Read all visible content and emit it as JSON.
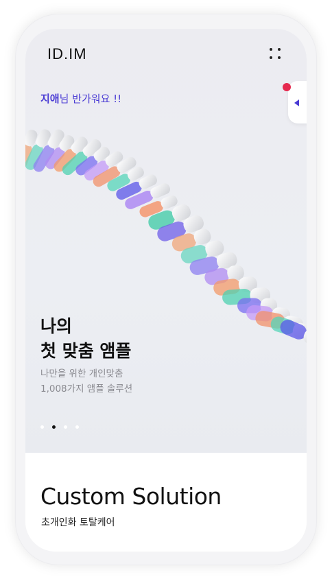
{
  "header": {
    "logo": "ID.IM",
    "menu_icon": "dots-grid-icon"
  },
  "greeting": {
    "name": "지애",
    "text": "님 반가워요 !!"
  },
  "side_tab": {
    "badge_color": "#e5294f",
    "arrow_icon": "caret-left-icon"
  },
  "hero": {
    "headline_line1": "나의",
    "headline_line2": "첫 맞춤 앰플",
    "sub_line1": "나만을 위한 개인맞춤",
    "sub_line2": "1,008가지 앰플 솔루션"
  },
  "carousel": {
    "total": 4,
    "active_index": 1
  },
  "section": {
    "title": "Custom Solution",
    "subtitle": "초개인화 토탈케어"
  },
  "colors": {
    "accent": "#4a3bd4",
    "badge": "#e5294f",
    "text": "#111111"
  }
}
